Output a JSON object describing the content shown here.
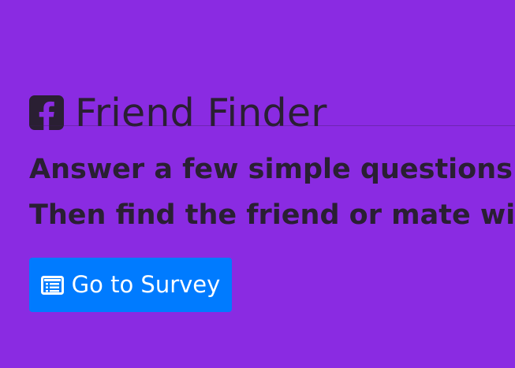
{
  "header": {
    "icon": "facebook-square-icon",
    "title": "Friend Finder"
  },
  "intro": {
    "line1": "Answer a few simple questions.",
    "line2": "Then find the friend or mate with"
  },
  "actions": {
    "survey_button_icon": "list-alt-icon",
    "survey_button_label": "Go to Survey"
  },
  "colors": {
    "background": "#8a2be2",
    "text": "#2a1f33",
    "button": "#007bff",
    "button_text": "#ffffff"
  }
}
